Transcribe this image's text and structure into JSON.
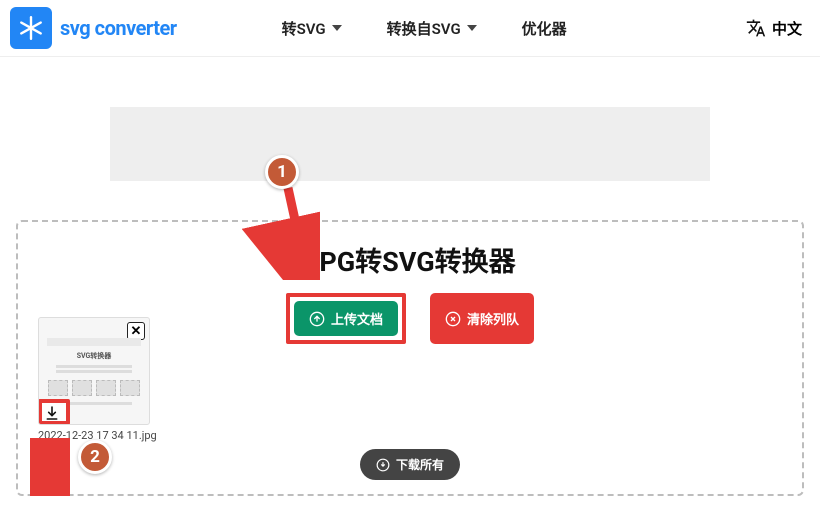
{
  "brand": "svg converter",
  "nav": {
    "to_svg": "转SVG",
    "from_svg": "转换自SVG",
    "optimizer": "优化器"
  },
  "lang": {
    "label": "中文"
  },
  "panel": {
    "title": "JPG转SVG转换器",
    "upload_label": "上传文档",
    "clear_label": "清除列队",
    "download_all_label": "下载所有"
  },
  "file": {
    "name": "2022-12-23 17 34 11.jpg",
    "thumb_title": "SVG转换器"
  },
  "annotations": {
    "marker1": "1",
    "marker2": "2"
  }
}
